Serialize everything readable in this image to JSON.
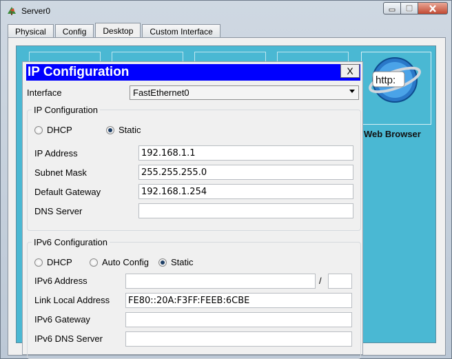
{
  "window": {
    "title": "Server0"
  },
  "tabs": [
    {
      "label": "Physical"
    },
    {
      "label": "Config"
    },
    {
      "label": "Desktop",
      "active": true
    },
    {
      "label": "Custom Interface"
    }
  ],
  "desktop": {
    "web_browser_label": "Web Browser",
    "web_browser_icon_text": "http:"
  },
  "dialog": {
    "title": "IP Configuration",
    "close_label": "X",
    "interface_label": "Interface",
    "interface_value": "FastEthernet0",
    "ipv4": {
      "group_title": "IP Configuration",
      "dhcp_label": "DHCP",
      "static_label": "Static",
      "selected": "Static",
      "ip_address_label": "IP Address",
      "ip_address": "192.168.1.1",
      "subnet_mask_label": "Subnet Mask",
      "subnet_mask": "255.255.255.0",
      "default_gateway_label": "Default Gateway",
      "default_gateway": "192.168.1.254",
      "dns_server_label": "DNS Server",
      "dns_server": ""
    },
    "ipv6": {
      "group_title": "IPv6 Configuration",
      "dhcp_label": "DHCP",
      "auto_config_label": "Auto Config",
      "static_label": "Static",
      "selected": "Static",
      "ipv6_address_label": "IPv6 Address",
      "ipv6_address": "",
      "prefix_separator": "/",
      "prefix_length": "",
      "link_local_label": "Link Local Address",
      "link_local_address": "FE80::20A:F3FF:FEEB:6CBE",
      "ipv6_gateway_label": "IPv6 Gateway",
      "ipv6_gateway": "",
      "ipv6_dns_label": "IPv6 DNS Server",
      "ipv6_dns": ""
    }
  },
  "colors": {
    "dialog_title_bg": "#0000ff",
    "desktop_bg": "#4ab8d3"
  },
  "icons": {
    "app": "packet-tracer-server-icon",
    "browser": "web-browser-globe-icon"
  }
}
